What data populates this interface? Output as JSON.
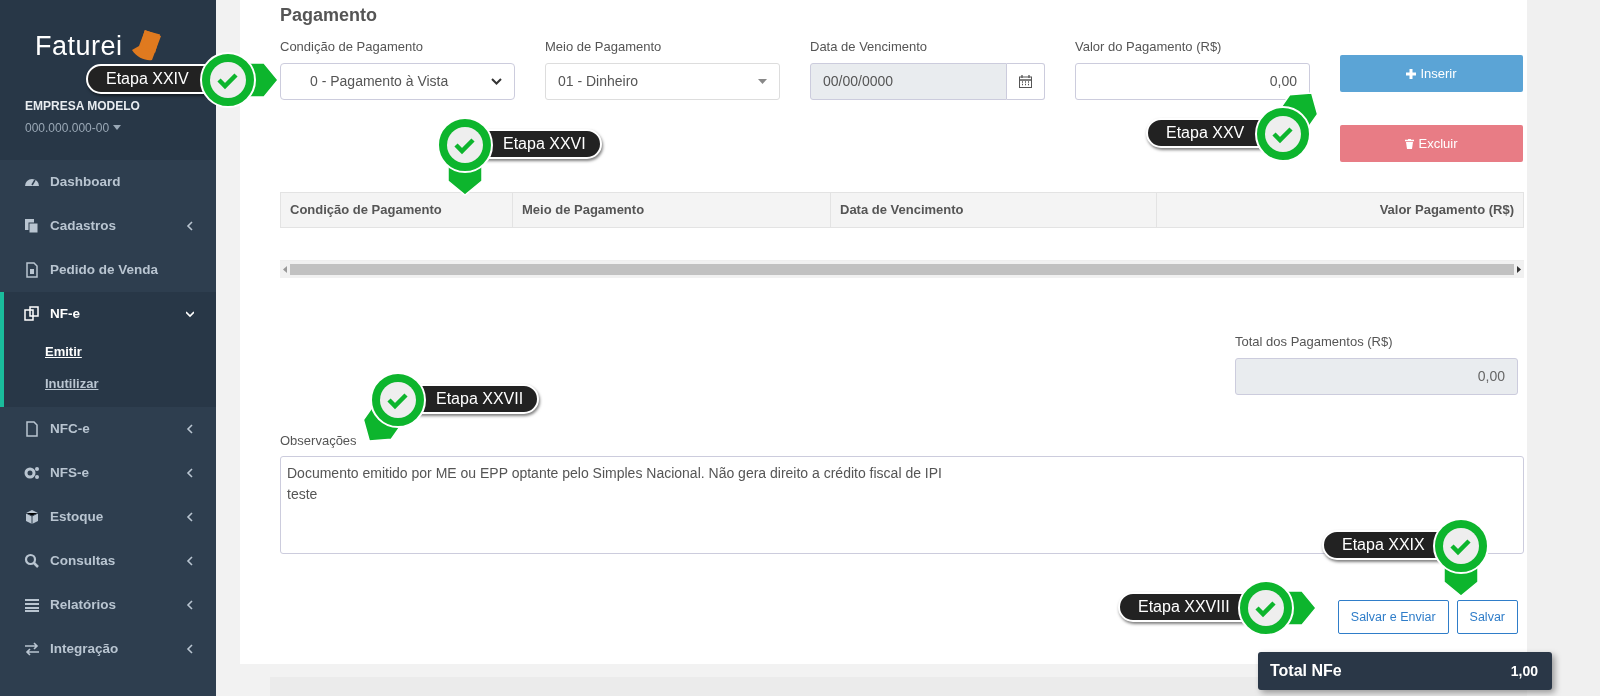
{
  "sidebar": {
    "logo": "Faturei",
    "company": "EMPRESA MODELO",
    "document": "000.000.000-00",
    "items": [
      {
        "label": "Dashboard",
        "expandable": false,
        "expanded": false,
        "selected": false
      },
      {
        "label": "Cadastros",
        "expandable": true,
        "expanded": false,
        "selected": false
      },
      {
        "label": "Pedido de Venda",
        "expandable": false,
        "expanded": false,
        "selected": false
      },
      {
        "label": "NF-e",
        "expandable": true,
        "expanded": true,
        "selected": true,
        "children": [
          {
            "label": "Emitir",
            "selected": true
          },
          {
            "label": "Inutilizar",
            "selected": false
          }
        ]
      },
      {
        "label": "NFC-e",
        "expandable": true,
        "expanded": false,
        "selected": false
      },
      {
        "label": "NFS-e",
        "expandable": true,
        "expanded": false,
        "selected": false
      },
      {
        "label": "Estoque",
        "expandable": true,
        "expanded": false,
        "selected": false
      },
      {
        "label": "Consultas",
        "expandable": true,
        "expanded": false,
        "selected": false
      },
      {
        "label": "Relatórios",
        "expandable": true,
        "expanded": false,
        "selected": false
      },
      {
        "label": "Integração",
        "expandable": true,
        "expanded": false,
        "selected": false
      }
    ]
  },
  "payment": {
    "title": "Pagamento",
    "fields": [
      {
        "label": "Condição de Pagamento",
        "kind": "select",
        "value": "0 - Pagamento à Vista",
        "disabled": false
      },
      {
        "label": "Meio de Pagamento",
        "kind": "combo",
        "value": "01 - Dinheiro",
        "disabled": false
      },
      {
        "label": "Data de Vencimento",
        "kind": "date",
        "value": "00/00/0000",
        "disabled": true
      },
      {
        "label": "Valor do Pagamento (R$)",
        "kind": "number",
        "value": "0,00",
        "disabled": false
      }
    ],
    "buttons": [
      {
        "label": "Inserir",
        "kind": "insert"
      },
      {
        "label": "Excluir",
        "kind": "delete"
      }
    ],
    "table": {
      "columns": [
        "Condição de Pagamento",
        "Meio de Pagamento",
        "Data de Vencimento",
        "Valor Pagamento (R$)"
      ]
    },
    "total": {
      "label": "Total dos Pagamentos (R$)",
      "value": "0,00"
    }
  },
  "notes": {
    "label": "Observações",
    "value": "Documento emitido por ME ou EPP optante pelo Simples Nacional. Não gera direito a crédito fiscal de IPI\nteste"
  },
  "actions": [
    {
      "label": "Salvar e Enviar"
    },
    {
      "label": "Salvar"
    }
  ],
  "total_nfe": {
    "label": "Total NFe",
    "value": "1,00"
  },
  "callouts": [
    {
      "label": "Etapa XXIV"
    },
    {
      "label": "Etapa XXVI"
    },
    {
      "label": "Etapa XXV"
    },
    {
      "label": "Etapa XXVII"
    },
    {
      "label": "Etapa XXIX"
    },
    {
      "label": "Etapa XXVIII"
    }
  ]
}
